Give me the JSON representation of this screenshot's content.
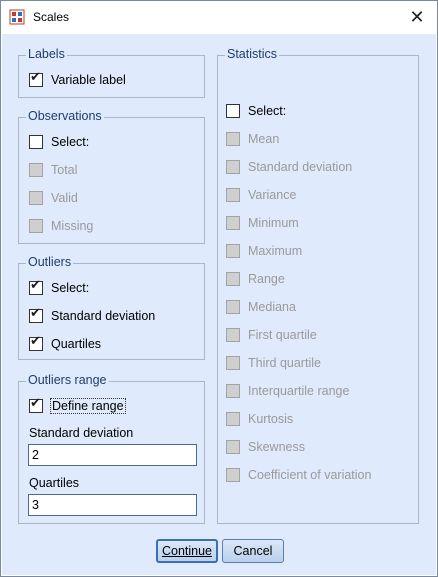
{
  "window": {
    "title": "Scales",
    "icon": "spss-scale-icon",
    "close_icon": "close-icon"
  },
  "labels_group": {
    "legend": "Labels",
    "items": [
      {
        "label": "Variable label",
        "checked": true,
        "enabled": true
      }
    ]
  },
  "observations_group": {
    "legend": "Observations",
    "items": [
      {
        "label": "Select:",
        "checked": false,
        "enabled": true
      },
      {
        "label": "Total",
        "checked": false,
        "enabled": false
      },
      {
        "label": "Valid",
        "checked": false,
        "enabled": false
      },
      {
        "label": "Missing",
        "checked": false,
        "enabled": false
      }
    ]
  },
  "outliers_group": {
    "legend": "Outliers",
    "items": [
      {
        "label": "Select:",
        "checked": true,
        "enabled": true
      },
      {
        "label": "Standard deviation",
        "checked": true,
        "enabled": true
      },
      {
        "label": "Quartiles",
        "checked": true,
        "enabled": true
      }
    ]
  },
  "outliers_range_group": {
    "legend": "Outliers range",
    "define_range": {
      "label": "Define range",
      "checked": true,
      "enabled": true
    },
    "std_label": "Standard deviation",
    "std_value": "2",
    "quartiles_label": "Quartiles",
    "quartiles_value": "3"
  },
  "statistics_group": {
    "legend": "Statistics",
    "items": [
      {
        "label": "Select:",
        "checked": false,
        "enabled": true
      },
      {
        "label": "Mean",
        "checked": false,
        "enabled": false
      },
      {
        "label": "Standard deviation",
        "checked": false,
        "enabled": false
      },
      {
        "label": "Variance",
        "checked": false,
        "enabled": false
      },
      {
        "label": "Minimum",
        "checked": false,
        "enabled": false
      },
      {
        "label": "Maximum",
        "checked": false,
        "enabled": false
      },
      {
        "label": "Range",
        "checked": false,
        "enabled": false
      },
      {
        "label": "Mediana",
        "checked": false,
        "enabled": false
      },
      {
        "label": "First quartile",
        "checked": false,
        "enabled": false
      },
      {
        "label": "Third quartile",
        "checked": false,
        "enabled": false
      },
      {
        "label": "Interquartile range",
        "checked": false,
        "enabled": false
      },
      {
        "label": "Kurtosis",
        "checked": false,
        "enabled": false
      },
      {
        "label": "Skewness",
        "checked": false,
        "enabled": false
      },
      {
        "label": "Coefficient of variation",
        "checked": false,
        "enabled": false
      }
    ]
  },
  "buttons": {
    "continue": "Continue",
    "cancel": "Cancel"
  },
  "colors": {
    "client_bg": "#dfeafc",
    "legend_text": "#1f3e6b",
    "group_border": "#a9b8c8",
    "disabled_text": "#9a9a9a"
  }
}
